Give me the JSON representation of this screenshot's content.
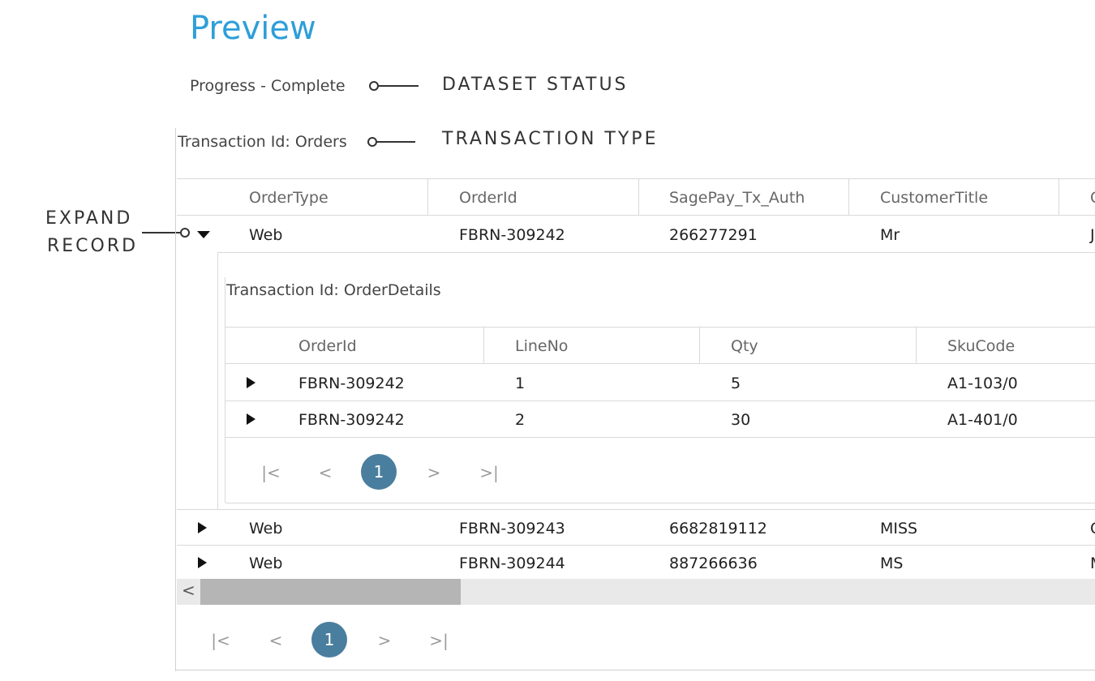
{
  "page": {
    "title": "Preview"
  },
  "status": {
    "text": "Progress - Complete"
  },
  "transaction": {
    "text": "Transaction Id: Orders"
  },
  "callouts": {
    "dataset_status": "DATASET STATUS",
    "transaction_type": "TRANSACTION TYPE",
    "expand_record_1": "EXPAND",
    "expand_record_2": "RECORD"
  },
  "orders": {
    "columns": [
      "OrderType",
      "OrderId",
      "SagePay_Tx_Auth",
      "CustomerTitle",
      "C"
    ],
    "rows": [
      {
        "OrderType": "Web",
        "OrderId": "FBRN-309242",
        "SagePay": "266277291",
        "CustomerTitle": "Mr",
        "Next": "J"
      },
      {
        "OrderType": "Web",
        "OrderId": "FBRN-309243",
        "SagePay": "6682819112",
        "CustomerTitle": "MISS",
        "Next": "C"
      },
      {
        "OrderType": "Web",
        "OrderId": "FBRN-309244",
        "SagePay": "887266636",
        "CustomerTitle": "MS",
        "Next": "M"
      }
    ]
  },
  "details": {
    "title": "Transaction Id: OrderDetails",
    "columns": [
      "OrderId",
      "LineNo",
      "Qty",
      "SkuCode"
    ],
    "rows": [
      {
        "OrderId": "FBRN-309242",
        "LineNo": "1",
        "Qty": "5",
        "SkuCode": "A1-103/0"
      },
      {
        "OrderId": "FBRN-309242",
        "LineNo": "2",
        "Qty": "30",
        "SkuCode": "A1-401/0"
      }
    ]
  },
  "pager": {
    "first": "|<",
    "prev": "<",
    "current": "1",
    "next": ">",
    "last": ">|"
  },
  "scrollbar": {
    "left_glyph": "<"
  },
  "icons": {
    "expand": "caret-right-icon",
    "collapse": "caret-down-icon"
  },
  "colors": {
    "title": "#2e9fd9",
    "pager_active": "#4a7e9e"
  }
}
